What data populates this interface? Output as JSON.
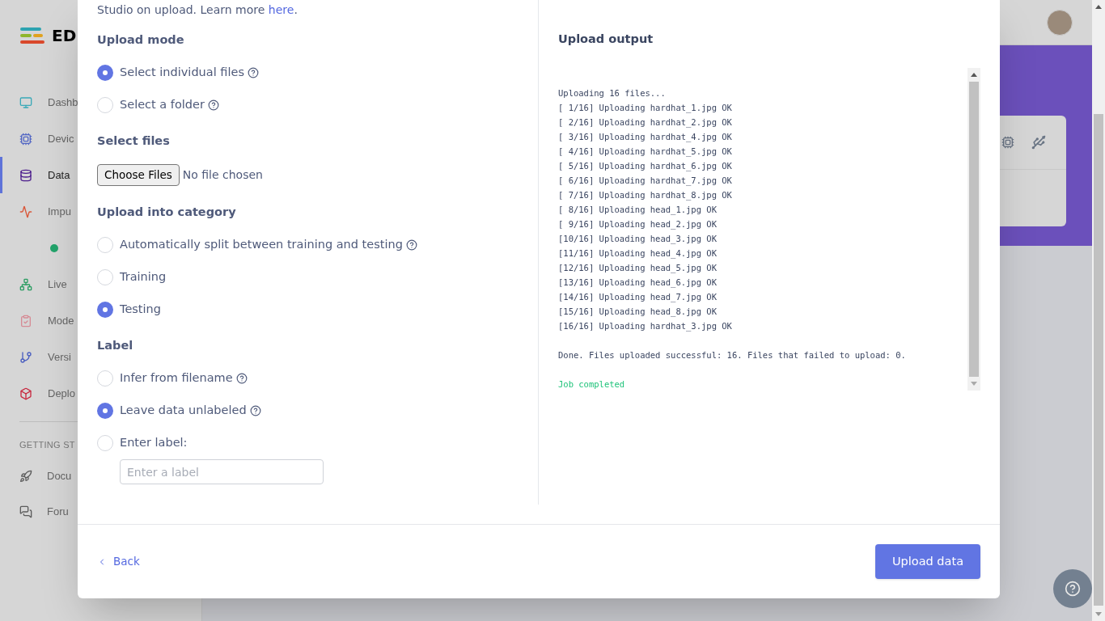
{
  "sidebar": {
    "logo": "ED",
    "items": [
      {
        "label": "Dashb",
        "selected": false
      },
      {
        "label": "Devic",
        "selected": false
      },
      {
        "label": "Data",
        "selected": true
      },
      {
        "label": "Impu",
        "selected": false
      },
      {
        "label": "Live",
        "selected": false
      },
      {
        "label": "Mode",
        "selected": false
      },
      {
        "label": "Versi",
        "selected": false
      },
      {
        "label": "Deplo",
        "selected": false
      }
    ],
    "section": "GETTING ST",
    "links": [
      {
        "label": "Docu"
      },
      {
        "label": "Foru"
      }
    ]
  },
  "dialog": {
    "intro": "Studio on upload. Learn more ",
    "intro_link": "here",
    "intro_end": ".",
    "upload_mode": {
      "title": "Upload mode",
      "options": [
        {
          "label": "Select individual files",
          "selected": true,
          "help": true
        },
        {
          "label": "Select a folder",
          "selected": false,
          "help": true
        }
      ]
    },
    "select_files": {
      "title": "Select files",
      "button": "Choose Files",
      "status": "No file chosen"
    },
    "category": {
      "title": "Upload into category",
      "options": [
        {
          "label": "Automatically split between training and testing",
          "selected": false,
          "help": true
        },
        {
          "label": "Training",
          "selected": false,
          "help": false
        },
        {
          "label": "Testing",
          "selected": true,
          "help": false
        }
      ]
    },
    "label": {
      "title": "Label",
      "options": [
        {
          "label": "Infer from filename",
          "selected": false,
          "help": true
        },
        {
          "label": "Leave data unlabeled",
          "selected": true,
          "help": true
        },
        {
          "label": "Enter label:",
          "selected": false,
          "help": false
        }
      ],
      "placeholder": "Enter a label"
    },
    "output": {
      "title": "Upload output",
      "blocks": [
        {
          "kind": "log",
          "lines": [
            "Uploading 16 files...",
            "[ 1/16] Uploading hardhat_1.jpg OK",
            "[ 2/16] Uploading hardhat_2.jpg OK",
            "[ 3/16] Uploading hardhat_4.jpg OK",
            "[ 4/16] Uploading hardhat_5.jpg OK",
            "[ 5/16] Uploading hardhat_6.jpg OK",
            "[ 6/16] Uploading hardhat_7.jpg OK",
            "[ 7/16] Uploading hardhat_8.jpg OK",
            "[ 8/16] Uploading head_1.jpg OK",
            "[ 9/16] Uploading head_2.jpg OK",
            "[10/16] Uploading head_3.jpg OK",
            "[11/16] Uploading head_4.jpg OK",
            "[12/16] Uploading head_5.jpg OK",
            "[13/16] Uploading head_6.jpg OK",
            "[14/16] Uploading head_7.jpg OK",
            "[15/16] Uploading head_8.jpg OK",
            "[16/16] Uploading hardhat_3.jpg OK"
          ]
        },
        {
          "kind": "log",
          "lines": [
            "Done. Files uploaded successful: 16. Files that failed to upload: 0."
          ]
        },
        {
          "kind": "success",
          "lines": [
            "Job completed"
          ]
        }
      ]
    },
    "back": "Back",
    "submit": "Upload data"
  }
}
